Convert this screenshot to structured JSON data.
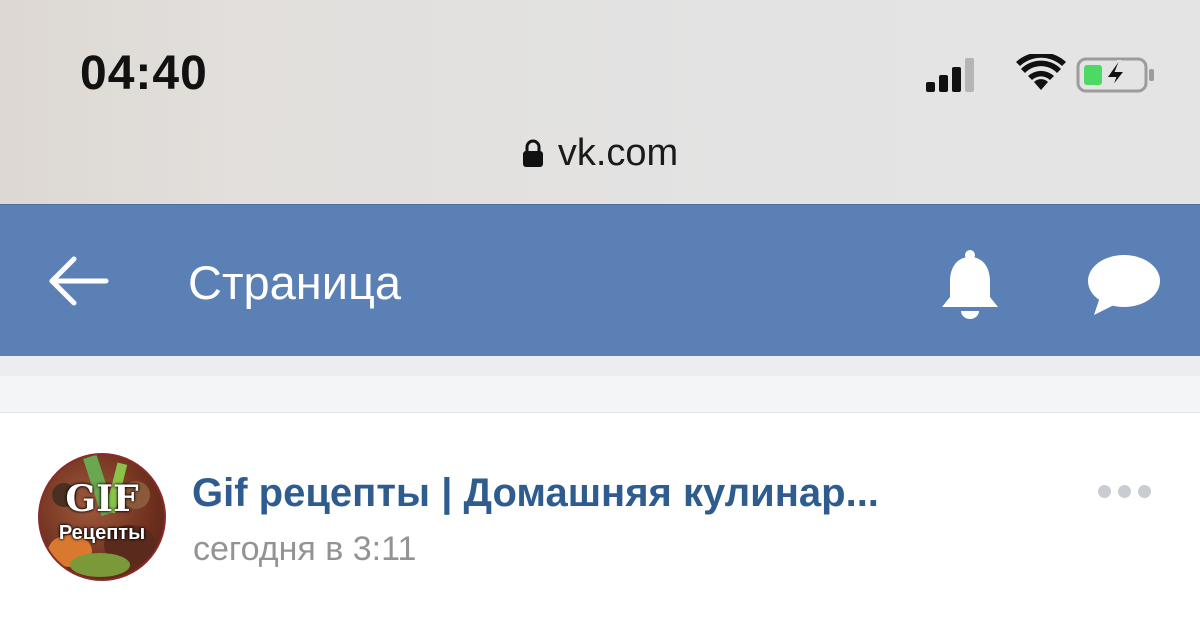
{
  "status_bar": {
    "time": "04:40",
    "icons": [
      "signal-icon",
      "wifi-icon",
      "battery-charging-icon"
    ]
  },
  "address_bar": {
    "url": "vk.com",
    "icon": "lock-icon"
  },
  "header": {
    "title": "Страница",
    "background": "#5b80b6",
    "icons": [
      "back-arrow-icon",
      "bell-icon",
      "chat-bubble-icon"
    ]
  },
  "post": {
    "author": "Gif рецепты | Домашняя кулинар...",
    "time": "сегодня в 3:11",
    "avatar": {
      "title": "GIF",
      "subtitle": "Рецепты"
    },
    "more_icon": "more-dots-icon"
  },
  "colors": {
    "accent": "#5b80b6",
    "author_link": "#2f5c8f",
    "muted_text": "#939393"
  }
}
